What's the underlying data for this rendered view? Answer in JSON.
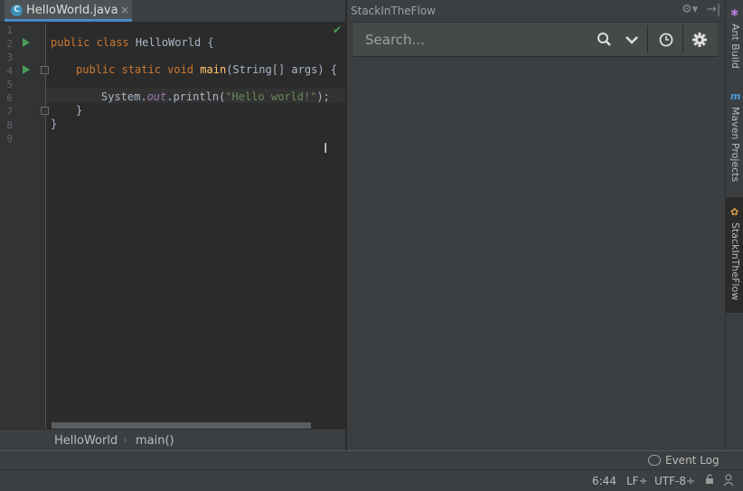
{
  "editor": {
    "tab": {
      "label": "HelloWorld.java",
      "icon": "c-class-icon",
      "icon_glyph": "C",
      "close_glyph": "×"
    },
    "line_numbers": [
      "1",
      "2",
      "3",
      "4",
      "5",
      "6",
      "7",
      "8",
      "9"
    ],
    "code": {
      "l2": {
        "kw": "public class ",
        "name": "HelloWorld",
        "rest": " {"
      },
      "l4": {
        "kw": "public static void ",
        "fn": "main",
        "rest": "(String[] args) {"
      },
      "l6": {
        "a": "System.",
        "b": "out",
        "c": ".println(",
        "d": "\"Hello world!\"",
        "e": ");"
      },
      "l7": "}",
      "l8": "}"
    },
    "breadcrumb": {
      "class": "HelloWorld",
      "separator": "›",
      "method": "main()"
    }
  },
  "tool_window": {
    "title": "StackInTheFlow",
    "gear_glyph": "⚙▾",
    "hide_glyph": "→|",
    "search": {
      "placeholder": "Search...",
      "value": ""
    }
  },
  "right_strip": {
    "ant": {
      "label": "Ant Build",
      "icon_glyph": "✱"
    },
    "maven": {
      "label": "Maven Projects",
      "icon_glyph": "m"
    },
    "stack": {
      "label": "StackInTheFlow",
      "icon_glyph": "✿"
    }
  },
  "event_log": {
    "label": "Event Log"
  },
  "status_bar": {
    "position": "6:44",
    "line_sep": "LF÷",
    "encoding": "UTF-8÷"
  },
  "colors": {
    "accent": "#4a88c7",
    "keyword": "#cc7832",
    "function": "#ffc66d",
    "string": "#6a8759",
    "run": "#499c54"
  }
}
